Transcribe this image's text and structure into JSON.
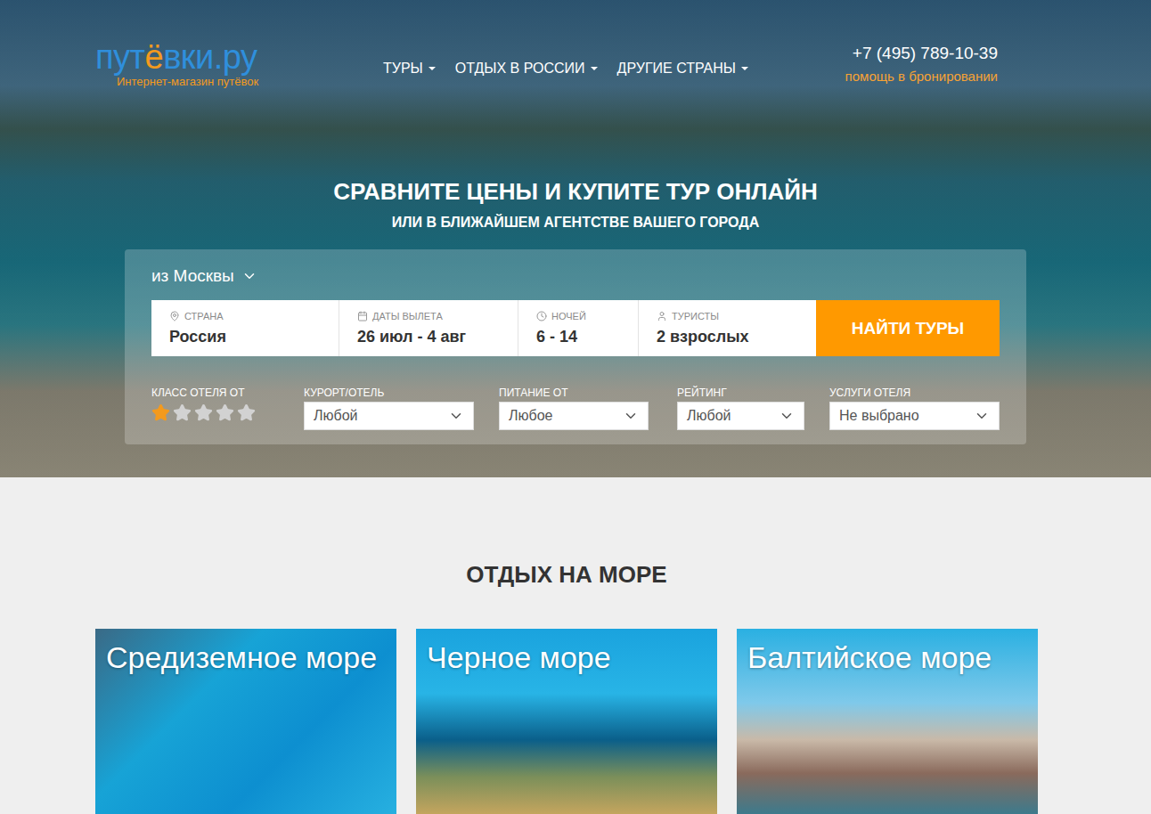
{
  "header": {
    "logo_parts": [
      "пут",
      "ё",
      "вки.ру"
    ],
    "logo_tagline": "Интернет-магазин путёвок",
    "nav": [
      {
        "label": "ТУРЫ"
      },
      {
        "label": "ОТДЫХ В РОССИИ"
      },
      {
        "label": "ДРУГИЕ СТРАНЫ"
      }
    ],
    "phone": "+7 (495) 789-10-39",
    "help": "помощь в бронировании"
  },
  "hero": {
    "title": "СРАВНИТЕ ЦЕНЫ И КУПИТЕ ТУР ОНЛАЙН",
    "subtitle": "ИЛИ В БЛИЖАЙШЕМ АГЕНТСТВЕ ВАШЕГО ГОРОДА"
  },
  "search": {
    "origin": "из Москвы",
    "fields": [
      {
        "label": "СТРАНА",
        "value": "Россия"
      },
      {
        "label": "ДАТЫ ВЫЛЕТА",
        "value": "26 июл - 4 авг"
      },
      {
        "label": "НОЧЕЙ",
        "value": "6 - 14"
      },
      {
        "label": "ТУРИСТЫ",
        "value": "2 взрослых"
      }
    ],
    "button": "НАЙТИ ТУРЫ",
    "hotel_class": {
      "label": "КЛАСС ОТЕЛЯ ОТ",
      "stars": 1
    },
    "filters": [
      {
        "label": "КУРОРТ/ОТЕЛЬ",
        "value": "Любой"
      },
      {
        "label": "ПИТАНИЕ ОТ",
        "value": "Любое"
      },
      {
        "label": "РЕЙТИНГ",
        "value": "Любой"
      },
      {
        "label": "УСЛУГИ ОТЕЛЯ",
        "value": "Не выбрано"
      }
    ]
  },
  "section": {
    "title": "ОТДЫХ НА МОРЕ",
    "cards": [
      {
        "title": "Средиземное море"
      },
      {
        "title": "Черное море"
      },
      {
        "title": "Балтийское море"
      }
    ]
  }
}
